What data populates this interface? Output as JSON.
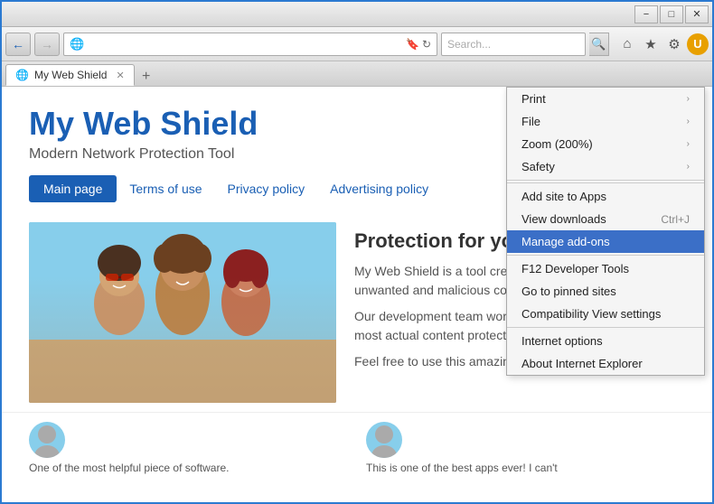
{
  "window": {
    "title_btn_min": "−",
    "title_btn_max": "□",
    "title_btn_close": "✕"
  },
  "navbar": {
    "back_title": "Back",
    "forward_title": "Forward",
    "address": "",
    "search_placeholder": "Search...",
    "globe": "🌐"
  },
  "tabs": [
    {
      "label": "My Web Shield",
      "active": true,
      "icon": "🌐"
    }
  ],
  "new_tab_label": "+",
  "website": {
    "title": "My Web Shield",
    "subtitle": "Modern Network Protection Tool",
    "nav": {
      "main_page": "Main page",
      "terms": "Terms of use",
      "privacy": "Privacy policy",
      "advertising": "Advertising policy"
    },
    "description_title": "Protection for your PC",
    "description_1": "My Web Shield is a tool created to protect your PC against unwanted and malicious content.",
    "description_2": "Our development team worked hard to provide you with most actual content protection system.",
    "description_3": "Feel free to use this amazing software",
    "testimonial_1": "One of the most helpful piece of software.",
    "testimonial_2": "This is one of the best apps ever! I can't"
  },
  "dropdown": {
    "items": [
      {
        "label": "Print",
        "shortcut": "",
        "arrow": "›",
        "highlighted": false
      },
      {
        "label": "File",
        "shortcut": "",
        "arrow": "›",
        "highlighted": false
      },
      {
        "label": "Zoom (200%)",
        "shortcut": "",
        "arrow": "›",
        "highlighted": false
      },
      {
        "label": "Safety",
        "shortcut": "",
        "arrow": "›",
        "highlighted": false
      },
      {
        "label": "Add site to Apps",
        "shortcut": "",
        "arrow": "",
        "highlighted": false
      },
      {
        "label": "View downloads",
        "shortcut": "Ctrl+J",
        "arrow": "",
        "highlighted": false
      },
      {
        "label": "Manage add-ons",
        "shortcut": "",
        "arrow": "",
        "highlighted": true
      },
      {
        "label": "F12 Developer Tools",
        "shortcut": "",
        "arrow": "",
        "highlighted": false
      },
      {
        "label": "Go to pinned sites",
        "shortcut": "",
        "arrow": "",
        "highlighted": false
      },
      {
        "label": "Compatibility View settings",
        "shortcut": "",
        "arrow": "",
        "highlighted": false
      },
      {
        "label": "Internet options",
        "shortcut": "",
        "arrow": "",
        "highlighted": false
      },
      {
        "label": "About Internet Explorer",
        "shortcut": "",
        "arrow": "",
        "highlighted": false
      }
    ]
  }
}
